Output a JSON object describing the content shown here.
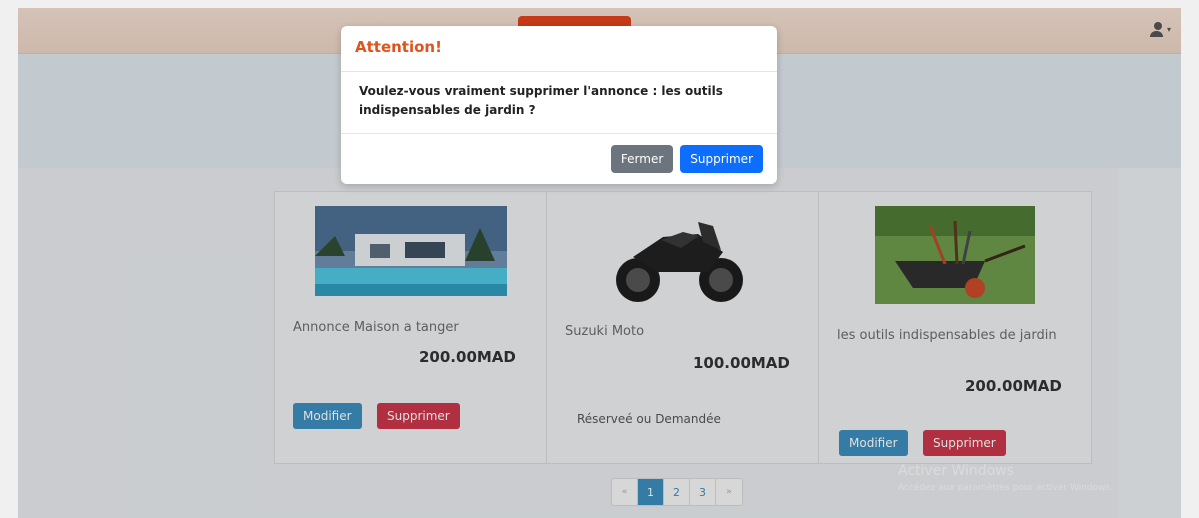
{
  "modal": {
    "title": "Attention!",
    "message": "Voulez-vous vraiment supprimer l'annonce : les outils indispensables de jardin ?",
    "close_label": "Fermer",
    "delete_label": "Supprimer"
  },
  "listings": [
    {
      "title": "Annonce Maison a tanger",
      "price": "200.00MAD",
      "edit_label": "Modifier",
      "delete_label": "Supprimer"
    },
    {
      "title": "Suzuki Moto",
      "price": "100.00MAD",
      "status": "Réserveé ou Demandée"
    },
    {
      "title": "les outils indispensables de jardin",
      "price": "200.00MAD",
      "edit_label": "Modifier",
      "delete_label": "Supprimer"
    }
  ],
  "pagination": {
    "prev": "«",
    "pages": [
      "1",
      "2",
      "3"
    ],
    "next": "»",
    "current": "1"
  },
  "watermark": {
    "title": "Activer Windows",
    "subtitle": "Accédez aux paramètres pour activer Windows."
  },
  "colors": {
    "accent_orange": "#e1431d",
    "primary_blue": "#0d6efd",
    "edit_blue": "#3c8dbc",
    "delete_red": "#c9374a"
  }
}
